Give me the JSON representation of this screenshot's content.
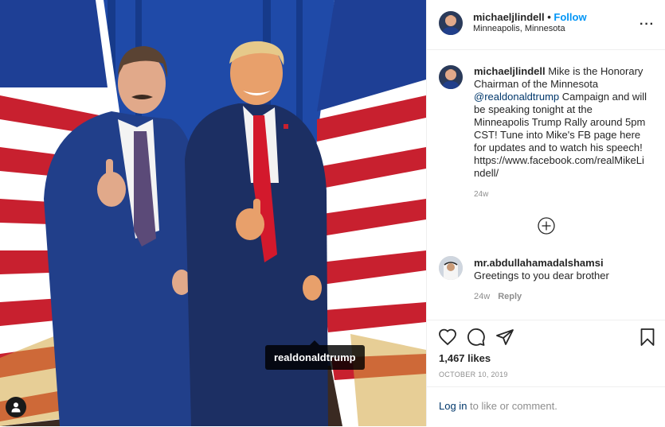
{
  "post": {
    "photo_tag": "realdonaldtrump",
    "user_tags_icon": "person-icon"
  },
  "header": {
    "username": "michaeljlindell",
    "separator": "•",
    "follow_label": "Follow",
    "location": "Minneapolis, Minnesota",
    "more_icon": "more-horizontal-icon",
    "more_label": "···"
  },
  "caption": {
    "username": "michaeljlindell",
    "text_before_mention": "Mike is the Honorary Chairman of the Minnesota ",
    "mention": "@realdonaldtrump",
    "text_after_mention": " Campaign and will be speaking tonight at the Minneapolis Trump Rally around 5pm CST! Tune into Mike's FB page here for updates and to watch his speech! https://www.facebook.com/realMikeLindell/",
    "time": "24w"
  },
  "load_more_icon": "plus-circle-icon",
  "comments": [
    {
      "username": "mr.abdullahamadalshamsi",
      "text": "Greetings to you dear brother",
      "time": "24w",
      "reply_label": "Reply"
    }
  ],
  "actions": {
    "icons": [
      "heart-icon",
      "comment-icon",
      "share-icon",
      "bookmark-icon"
    ],
    "likes": "1,467 likes",
    "date": "OCTOBER 10, 2019"
  },
  "footer": {
    "login_link": "Log in",
    "login_text": " to like or comment."
  },
  "colors": {
    "link_blue": "#0095f6",
    "mention_blue": "#00376b",
    "muted_gray": "#8e8e8e",
    "border": "#efefef"
  }
}
